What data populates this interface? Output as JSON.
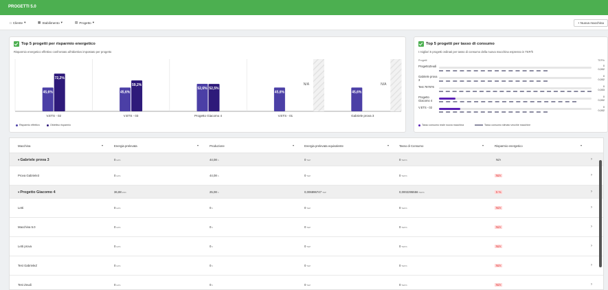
{
  "header": {
    "title": "PROGETTI 5.0"
  },
  "toolbar": {
    "filters": [
      {
        "icon": "building-icon",
        "label": "Cliente"
      },
      {
        "icon": "factory-icon",
        "label": "Stabilimento"
      },
      {
        "icon": "file-icon",
        "label": "Progetto"
      }
    ],
    "new_button": "+ Nuova macchina"
  },
  "savings_card": {
    "title": "Top 5 progetti per risparmio energetico",
    "subtitle": "Risparmio energetico effettivo confrontato all'obiettivo impostato per progetto",
    "legend_actual": "Risparmio effettivo",
    "legend_target": "Obiettivo risparmio",
    "colors": {
      "actual": "#4b3fa6",
      "target": "#2e1a7a"
    }
  },
  "chart_data": {
    "type": "bar",
    "categories": [
      "V.ETS - 02",
      "V.ETS - 03",
      "Progetto Giacomo 4",
      "V.ETS - 01",
      "Gabriele prova 3"
    ],
    "series": [
      {
        "name": "Risparmio effettivo",
        "values": [
          45.6,
          45.6,
          52.6,
          45.6,
          45.6
        ],
        "labels": [
          "45,6%",
          "45,6%",
          "52,6%",
          "45,6%",
          "45,6%"
        ]
      },
      {
        "name": "Obiettivo risparmio",
        "values": [
          72.2,
          59.2,
          52.5,
          null,
          null
        ],
        "labels": [
          "72,2%",
          "59,2%",
          "52,5%",
          "N/A",
          "N/A"
        ]
      }
    ],
    "ylim": [
      0,
      100
    ]
  },
  "consumption_card": {
    "title": "Top 5 progetti per tasso di consumo",
    "subtitle": "I migliori 5 progetti ordinati per tasso di consumo della nuova macchina espresso in TEP/h",
    "col_projects": "Progetti",
    "col_unit": "TEP/h",
    "legend_new": "Tasso consumo reale nuova macchina",
    "legend_old": "Tasso consumo stimato vecchie macchine",
    "projects": [
      {
        "name": "ProgettoZeudi",
        "real": "0",
        "est": "0,002",
        "real_frac": 0.0,
        "est_frac": 0.71
      },
      {
        "name": "Gabriele prova 3",
        "real": "0",
        "est": "0,002",
        "real_frac": 0.0,
        "est_frac": 0.71
      },
      {
        "name": "Test 787676",
        "real": "0",
        "est": "0,003",
        "real_frac": 0.0,
        "est_frac": 1.0
      },
      {
        "name": "Progetto Giacomo 4",
        "real": "0",
        "est": "0,002",
        "real_frac": 0.11,
        "est_frac": 0.9
      },
      {
        "name": "V.ETS - 02",
        "real": "0",
        "est": "0,002",
        "real_frac": 0.14,
        "est_frac": 0.71
      }
    ]
  },
  "table": {
    "headers": [
      "Macchina",
      "Energia prelevata",
      "Produzione",
      "Energia prelevata equivalente",
      "Tasso di Consumo",
      "Risparmio energetico"
    ],
    "rows": [
      {
        "group": true,
        "name": "Gabriele prova 3",
        "energia": "0",
        "energia_u": "kWh",
        "produzione": "44,08",
        "produzione_u": "h",
        "equiv": "0",
        "equiv_u": "TEP",
        "tasso": "0",
        "tasso_u": "TEP/h",
        "risparmio": "N/A"
      },
      {
        "group": false,
        "name": "Prova Gabriele3",
        "energia": "0",
        "energia_u": "kWh",
        "produzione": "44,08",
        "produzione_u": "h",
        "equiv": "0",
        "equiv_u": "TEP",
        "tasso": "0",
        "tasso_u": "TEP/h",
        "risparmio": "N/A"
      },
      {
        "group": true,
        "name": "Progetto Giacomo 4",
        "energia": "36,88",
        "energia_u": "kWh",
        "produzione": "25,08",
        "produzione_u": "h",
        "equiv": "0,006896747",
        "equiv_u": "TEP",
        "tasso": "0,0002295556",
        "tasso_u": "TEP/h",
        "risparmio": "5 %"
      },
      {
        "group": false,
        "name": "Letti",
        "energia": "0",
        "energia_u": "kWh",
        "produzione": "0",
        "produzione_u": "h",
        "equiv": "0",
        "equiv_u": "TEP",
        "tasso": "0",
        "tasso_u": "TEP/h",
        "risparmio": "N/A"
      },
      {
        "group": false,
        "name": "Macchina 5.0",
        "energia": "0",
        "energia_u": "kWh",
        "produzione": "0",
        "produzione_u": "h",
        "equiv": "0",
        "equiv_u": "TEP",
        "tasso": "0",
        "tasso_u": "TEP/h",
        "risparmio": "N/A"
      },
      {
        "group": false,
        "name": "Letti prova",
        "energia": "0",
        "energia_u": "kWh",
        "produzione": "0",
        "produzione_u": "h",
        "equiv": "0",
        "equiv_u": "TEP",
        "tasso": "0",
        "tasso_u": "TEP/h",
        "risparmio": "N/A"
      },
      {
        "group": false,
        "name": "Test GabrieleZ",
        "energia": "0",
        "energia_u": "kWh",
        "produzione": "0",
        "produzione_u": "h",
        "equiv": "0",
        "equiv_u": "TEP",
        "tasso": "0",
        "tasso_u": "TEP/h",
        "risparmio": "N/A"
      },
      {
        "group": false,
        "name": "Test Zeudi",
        "energia": "0",
        "energia_u": "kWh",
        "produzione": "0",
        "produzione_u": "h",
        "equiv": "0",
        "equiv_u": "TEP",
        "tasso": "0",
        "tasso_u": "TEP/h",
        "risparmio": "N/A"
      }
    ]
  }
}
